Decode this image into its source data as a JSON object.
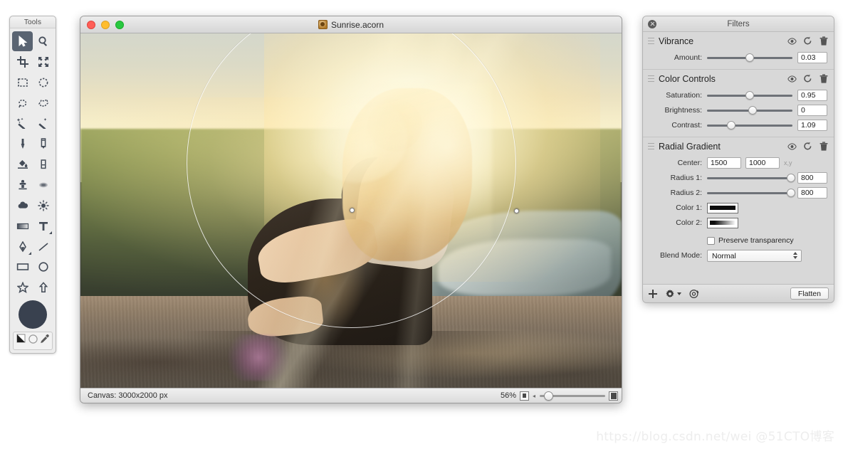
{
  "tools_palette": {
    "title": "Tools",
    "tools": [
      {
        "name": "move-tool",
        "icon": "arrow-pointer-icon",
        "selected": true
      },
      {
        "name": "zoom-tool",
        "icon": "magnifier-icon",
        "selected": false
      },
      {
        "name": "crop-tool",
        "icon": "crop-icon",
        "selected": false
      },
      {
        "name": "transform-tool",
        "icon": "transform-arrows-icon",
        "selected": false
      },
      {
        "name": "rect-select-tool",
        "icon": "rectangular-marquee-icon",
        "selected": false
      },
      {
        "name": "ellipse-select-tool",
        "icon": "elliptical-marquee-icon",
        "selected": false
      },
      {
        "name": "lasso-tool",
        "icon": "lasso-icon",
        "selected": false
      },
      {
        "name": "polygon-lasso-tool",
        "icon": "polygon-lasso-icon",
        "selected": false
      },
      {
        "name": "magic-wand-tool",
        "icon": "magic-wand-icon",
        "selected": false
      },
      {
        "name": "instant-alpha-tool",
        "icon": "sparkle-wand-icon",
        "selected": false
      },
      {
        "name": "brush-tool",
        "icon": "brush-icon",
        "selected": false
      },
      {
        "name": "pencil-tool",
        "icon": "pencil-icon",
        "selected": false
      },
      {
        "name": "paint-bucket-tool",
        "icon": "paint-bucket-icon",
        "selected": false
      },
      {
        "name": "eraser-tool",
        "icon": "eraser-icon",
        "selected": false
      },
      {
        "name": "clone-stamp-tool",
        "icon": "clone-stamp-icon",
        "selected": false
      },
      {
        "name": "blur-tool",
        "icon": "blur-smudge-icon",
        "selected": false
      },
      {
        "name": "dodge-tool",
        "icon": "cloud-burn-icon",
        "selected": false
      },
      {
        "name": "burn-tool",
        "icon": "sun-dodge-icon",
        "selected": false
      },
      {
        "name": "gradient-tool",
        "icon": "gradient-icon",
        "selected": false
      },
      {
        "name": "text-tool",
        "icon": "text-t-icon",
        "selected": false
      },
      {
        "name": "bezier-pen-tool",
        "icon": "bezier-pen-icon",
        "selected": false
      },
      {
        "name": "line-tool",
        "icon": "line-icon",
        "selected": false
      },
      {
        "name": "rectangle-shape-tool",
        "icon": "rectangle-icon",
        "selected": false
      },
      {
        "name": "ellipse-shape-tool",
        "icon": "ellipse-icon",
        "selected": false
      },
      {
        "name": "star-shape-tool",
        "icon": "star-icon",
        "selected": false
      },
      {
        "name": "arrow-shape-tool",
        "icon": "arrow-up-icon",
        "selected": false
      }
    ],
    "color_swatches": [
      "foreground-background-swatch-icon",
      "reset-colors-icon",
      "eyedropper-icon"
    ],
    "brush_preview_color": "#39414f"
  },
  "document_window": {
    "title": "Sunrise.acorn",
    "app_icon": "acorn-document-icon",
    "traffic_lights": {
      "close": "#ff5f57",
      "minimize": "#ffbd2e",
      "zoom": "#28c840"
    },
    "status_bar": {
      "canvas_label": "Canvas: 3000x2000 px",
      "zoom_percent": "56%",
      "small_thumb_icon": "small-image-icon",
      "large_thumb_icon": "large-image-icon",
      "zoom_slider_value": 8
    },
    "gradient_overlay": {
      "center_handle": "radial-gradient-center-handle",
      "edge_handle": "radial-gradient-radius-handle"
    }
  },
  "filters_panel": {
    "title": "Filters",
    "close_icon": "close-icon",
    "row_action_icons": [
      "eye-visibility-icon",
      "reset-icon",
      "trash-delete-icon"
    ],
    "sections": [
      {
        "name": "Vibrance",
        "rows": [
          {
            "label": "Amount:",
            "value": "0.03",
            "slider_pct": 45
          }
        ]
      },
      {
        "name": "Color Controls",
        "rows": [
          {
            "label": "Saturation:",
            "value": "0.95",
            "slider_pct": 45
          },
          {
            "label": "Brightness:",
            "value": "0",
            "slider_pct": 48
          },
          {
            "label": "Contrast:",
            "value": "1.09",
            "slider_pct": 23
          }
        ]
      },
      {
        "name": "Radial Gradient",
        "center": {
          "label": "Center:",
          "x": "1500",
          "y": "1000",
          "axis_hint": "x,y"
        },
        "rows": [
          {
            "label": "Radius 1:",
            "value": "800",
            "slider_pct": 93
          },
          {
            "label": "Radius 2:",
            "value": "800",
            "slider_pct": 93
          }
        ],
        "colors": [
          {
            "label": "Color 1:",
            "swatch": "solid-black-swatch"
          },
          {
            "label": "Color 2:",
            "swatch": "black-to-transparent-gradient-swatch"
          }
        ],
        "preserve_transparency": {
          "label": "Preserve transparency",
          "checked": false
        },
        "blend_mode": {
          "label": "Blend Mode:",
          "value": "Normal"
        }
      }
    ],
    "footer": {
      "add_icon": "plus-add-filter-icon",
      "settings_icon": "gear-options-icon",
      "presets_icon": "preset-eye-icon",
      "flatten_label": "Flatten"
    }
  },
  "watermark": {
    "text": "https://blog.csdn.net/wei @51CTO博客"
  }
}
